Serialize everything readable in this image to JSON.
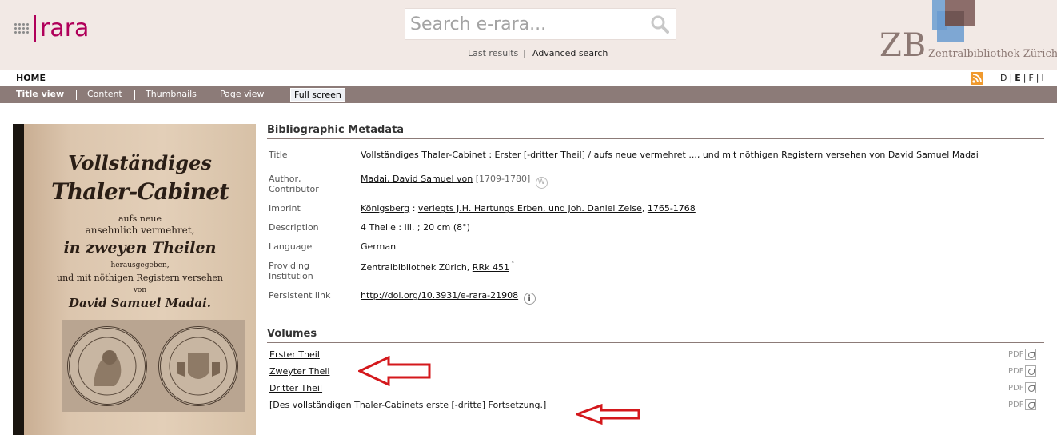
{
  "header": {
    "logo_word": "rara",
    "search_placeholder": "Search e-rara...",
    "last_results": "Last results",
    "separator": "|",
    "advanced_search": "Advanced search",
    "library_letters": "ZB",
    "library_name": "Zentralbibliothek Zürich"
  },
  "topnav": {
    "home": "HOME",
    "languages": [
      "D",
      "E",
      "F",
      "I"
    ],
    "selected_language": "E"
  },
  "viewnav": {
    "items": [
      "Title view",
      "Content",
      "Thumbnails",
      "Page view"
    ],
    "active": "Title view",
    "fullscreen": "Full screen"
  },
  "cover": {
    "lines": [
      "Vollständiges",
      "Thaler-Cabinet",
      "aufs neue",
      "ansehnlich vermehret,",
      "in zweyen Theilen",
      "herausgegeben,",
      "und mit nöthigen Registern versehen",
      "von",
      "David Samuel Madai."
    ]
  },
  "metadata": {
    "heading": "Bibliographic Metadata",
    "title_label": "Title",
    "title_value": "Vollständiges Thaler-Cabinet : Erster [-dritter Theil] / aufs neue vermehret ..., und mit nöthigen Registern versehen von David Samuel Madai",
    "author_label": "Author, Contributor",
    "author_name": "Madai, David Samuel von",
    "author_dates": "[1709-1780]",
    "imprint_label": "Imprint",
    "imprint_place": "Königsberg",
    "imprint_sep1": " : ",
    "imprint_publisher": "verlegts J.H. Hartungs Erben, und Joh. Daniel Zeise",
    "imprint_sep2": ", ",
    "imprint_years": "1765-1768",
    "description_label": "Description",
    "description_value": "4 Theile : Ill. ; 20 cm (8°)",
    "language_label": "Language",
    "language_value": "German",
    "institution_label": "Providing Institution",
    "institution_name": "Zentralbibliothek Zürich, ",
    "institution_shelfmark": "RRk 451",
    "persistent_label": "Persistent link",
    "persistent_value": "http://doi.org/10.3931/e-rara-21908"
  },
  "volumes": {
    "heading": "Volumes",
    "pdf_label": "PDF",
    "items": [
      "Erster Theil",
      "Zweyter Theil",
      "Dritter Theil",
      "[Des vollständigen Thaler-Cabinets erste [-dritte] Fortsetzung.]"
    ]
  },
  "colors": {
    "brand": "#b0005a",
    "nav_bar": "#8c7b78",
    "header_bg": "#f2e9e5",
    "arrow": "#d4181c"
  }
}
